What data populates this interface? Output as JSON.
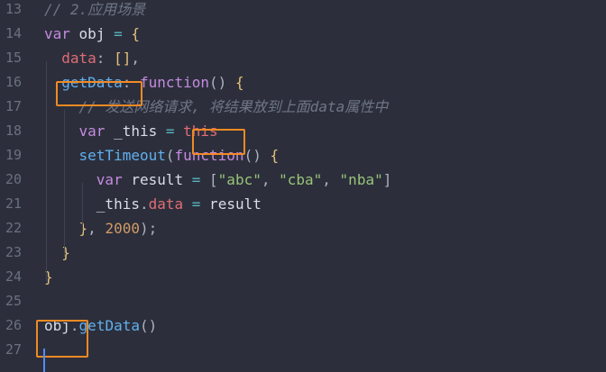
{
  "lines": [
    {
      "num": "13",
      "tokens": [
        {
          "t": "// 2.应用场景",
          "c": "comment"
        }
      ]
    },
    {
      "num": "14",
      "tokens": [
        {
          "t": "var",
          "c": "kw"
        },
        {
          "t": " obj ",
          "c": "plain"
        },
        {
          "t": "=",
          "c": "op"
        },
        {
          "t": " ",
          "c": "plain"
        },
        {
          "t": "{",
          "c": "brace"
        }
      ]
    },
    {
      "num": "15",
      "tokens": [
        {
          "t": "  ",
          "c": "plain"
        },
        {
          "t": "data",
          "c": "prop"
        },
        {
          "t": ": ",
          "c": "punc"
        },
        {
          "t": "[]",
          "c": "brace"
        },
        {
          "t": ",",
          "c": "punc"
        }
      ]
    },
    {
      "num": "16",
      "tokens": [
        {
          "t": "  ",
          "c": "plain"
        },
        {
          "t": "getData",
          "c": "fn"
        },
        {
          "t": ": ",
          "c": "punc"
        },
        {
          "t": "function",
          "c": "kw"
        },
        {
          "t": "() ",
          "c": "punc"
        },
        {
          "t": "{",
          "c": "brace"
        }
      ]
    },
    {
      "num": "17",
      "tokens": [
        {
          "t": "    ",
          "c": "plain"
        },
        {
          "t": "// 发送网络请求, 将结果放到上面data属性中",
          "c": "comment"
        }
      ]
    },
    {
      "num": "18",
      "tokens": [
        {
          "t": "    ",
          "c": "plain"
        },
        {
          "t": "var",
          "c": "kw"
        },
        {
          "t": " _this ",
          "c": "plain"
        },
        {
          "t": "=",
          "c": "op"
        },
        {
          "t": " ",
          "c": "plain"
        },
        {
          "t": "this",
          "c": "prop"
        }
      ]
    },
    {
      "num": "19",
      "tokens": [
        {
          "t": "    ",
          "c": "plain"
        },
        {
          "t": "setTimeout",
          "c": "fn"
        },
        {
          "t": "(",
          "c": "punc"
        },
        {
          "t": "function",
          "c": "kw"
        },
        {
          "t": "() ",
          "c": "punc"
        },
        {
          "t": "{",
          "c": "brace"
        }
      ]
    },
    {
      "num": "20",
      "tokens": [
        {
          "t": "      ",
          "c": "plain"
        },
        {
          "t": "var",
          "c": "kw"
        },
        {
          "t": " result ",
          "c": "plain"
        },
        {
          "t": "=",
          "c": "op"
        },
        {
          "t": " [",
          "c": "punc"
        },
        {
          "t": "\"abc\"",
          "c": "str"
        },
        {
          "t": ", ",
          "c": "punc"
        },
        {
          "t": "\"cba\"",
          "c": "str"
        },
        {
          "t": ", ",
          "c": "punc"
        },
        {
          "t": "\"nba\"",
          "c": "str"
        },
        {
          "t": "]",
          "c": "punc"
        }
      ]
    },
    {
      "num": "21",
      "tokens": [
        {
          "t": "      ",
          "c": "plain"
        },
        {
          "t": "_this",
          "c": "plain"
        },
        {
          "t": ".",
          "c": "punc"
        },
        {
          "t": "data",
          "c": "prop"
        },
        {
          "t": " ",
          "c": "plain"
        },
        {
          "t": "=",
          "c": "op"
        },
        {
          "t": " result",
          "c": "plain"
        }
      ]
    },
    {
      "num": "22",
      "tokens": [
        {
          "t": "    ",
          "c": "plain"
        },
        {
          "t": "}",
          "c": "brace"
        },
        {
          "t": ", ",
          "c": "punc"
        },
        {
          "t": "2000",
          "c": "num"
        },
        {
          "t": ")",
          "c": "punc"
        },
        {
          "t": ";",
          "c": "punc"
        }
      ]
    },
    {
      "num": "23",
      "tokens": [
        {
          "t": "  ",
          "c": "plain"
        },
        {
          "t": "}",
          "c": "brace"
        }
      ]
    },
    {
      "num": "24",
      "tokens": [
        {
          "t": "}",
          "c": "brace"
        }
      ]
    },
    {
      "num": "25",
      "tokens": []
    },
    {
      "num": "26",
      "tokens": [
        {
          "t": "obj",
          "c": "plain"
        },
        {
          "t": ".",
          "c": "punc"
        },
        {
          "t": "getData",
          "c": "fn"
        },
        {
          "t": "()",
          "c": "punc"
        }
      ]
    },
    {
      "num": "27",
      "tokens": []
    }
  ],
  "highlight_color": "#f08a24",
  "cursor_color": "#528bff"
}
